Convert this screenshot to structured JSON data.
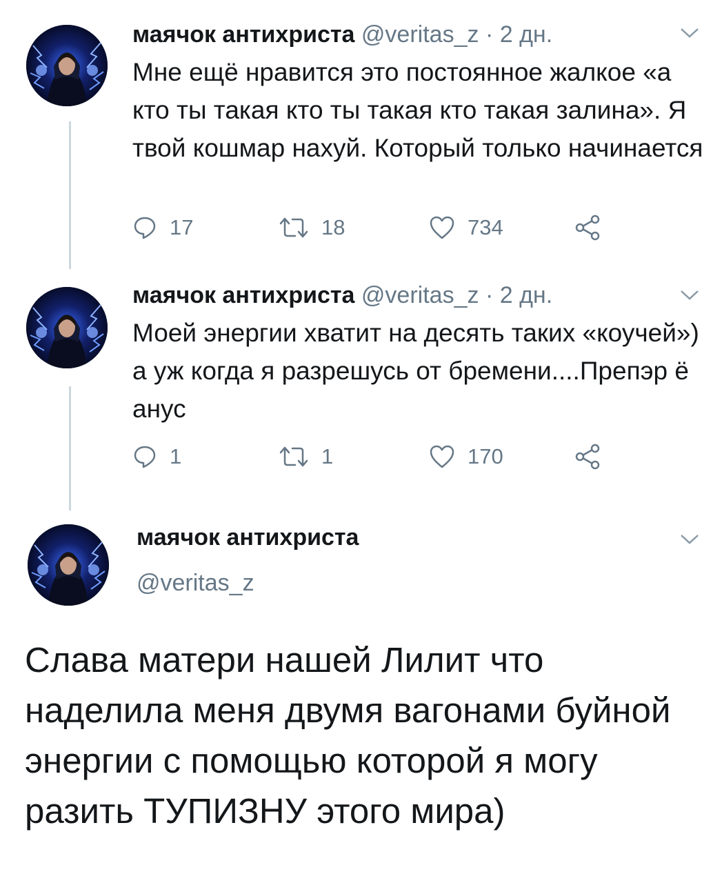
{
  "tweets": [
    {
      "name": "маячок антихриста",
      "handle": "@veritas_z",
      "separator": "·",
      "time": "2 дн.",
      "text": "Мне ещё нравится это постоянное жалкое «а кто ты такая кто ты такая кто такая залина». Я твой кошмар нахуй. Который только начинается",
      "replies": "17",
      "retweets": "18",
      "likes": "734"
    },
    {
      "name": "маячок антихриста",
      "handle": "@veritas_z",
      "separator": "·",
      "time": "2 дн.",
      "text": "Моей энергии хватит на десять таких «коучей») а уж когда я разрешусь от бремени....Препэр ё анус",
      "replies": "1",
      "retweets": "1",
      "likes": "170"
    }
  ],
  "main_tweet": {
    "name": "маячок антихриста",
    "handle": "@veritas_z",
    "text": "Слава матери нашей Лилит что наделила меня двумя вагонами буйной энергии с помощью которой я могу разить ТУПИЗНУ этого мира)"
  },
  "icons": {
    "reply": "reply-icon",
    "retweet": "retweet-icon",
    "like": "heart-icon",
    "share": "share-icon",
    "menu": "chevron-down-icon"
  },
  "colors": {
    "text": "#14171a",
    "secondary": "#657786",
    "thread_line": "#ccd6dd",
    "avatar_bg": "#050a2a",
    "lightning": "#4f8dff"
  }
}
